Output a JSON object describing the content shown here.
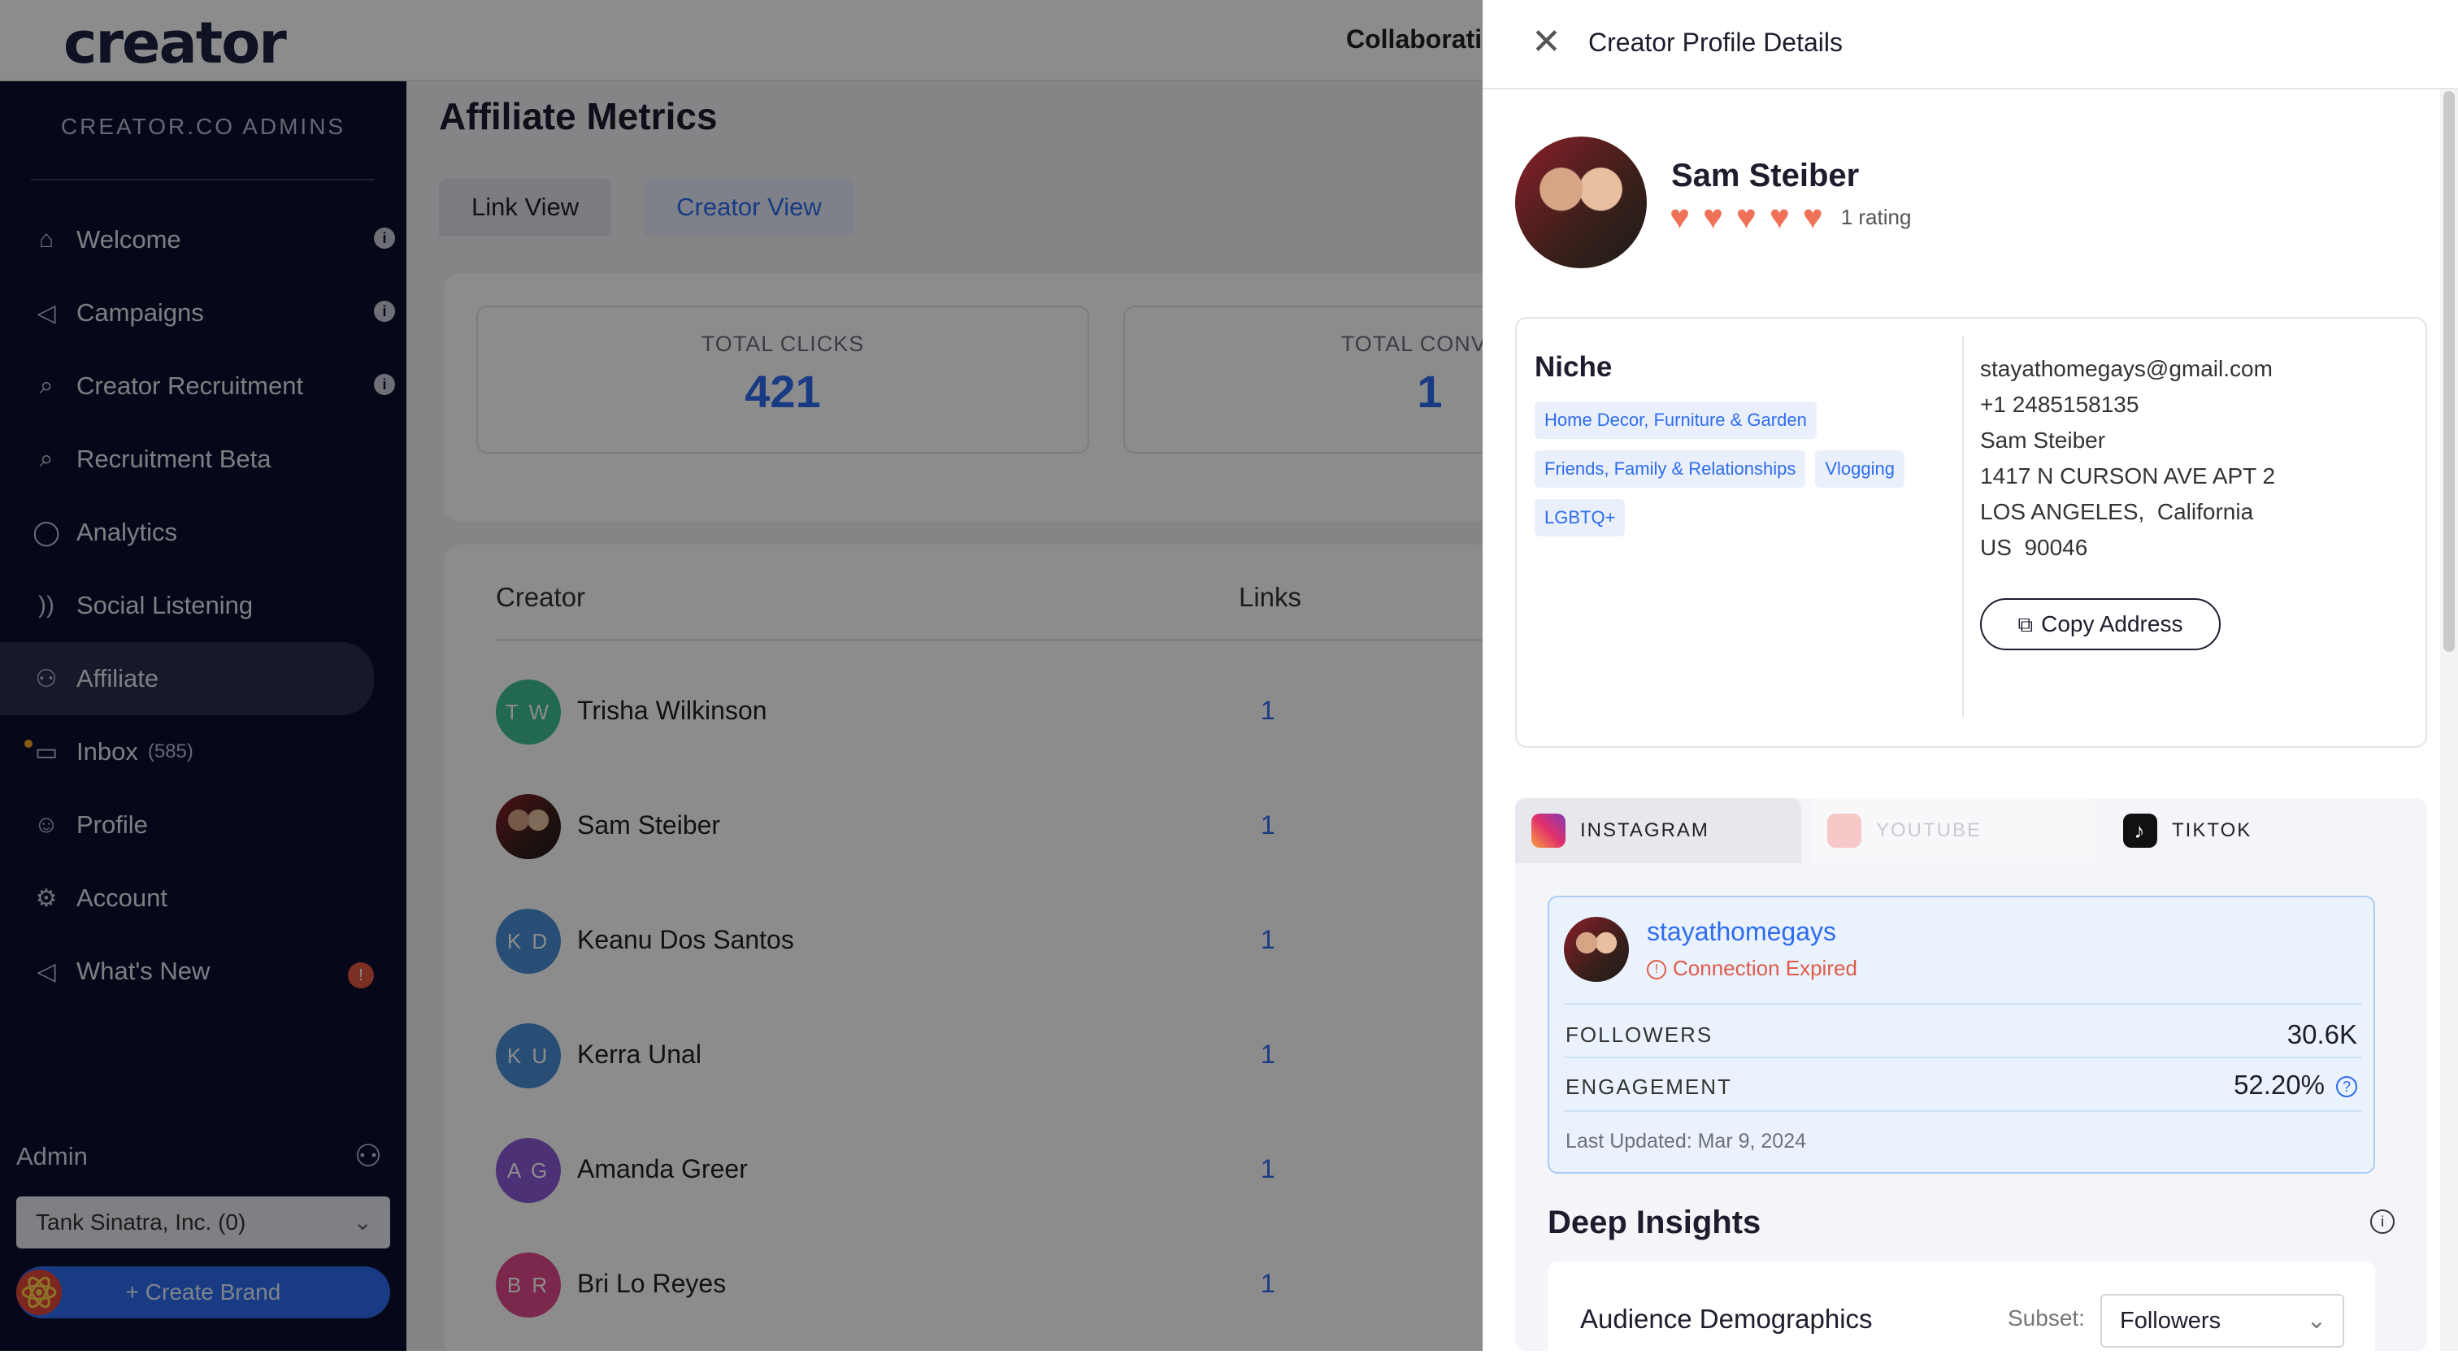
{
  "app": {
    "logo": "creator",
    "topnav_partial": "Collaborati"
  },
  "sidebar": {
    "title": "CREATOR.CO ADMINS",
    "items": [
      {
        "label": "Welcome",
        "icon": "home-icon",
        "glyph": "⌂",
        "info": true
      },
      {
        "label": "Campaigns",
        "icon": "megaphone-icon",
        "glyph": "◁",
        "info": true
      },
      {
        "label": "Creator Recruitment",
        "icon": "search-icon",
        "glyph": "⌕",
        "info": true
      },
      {
        "label": "Recruitment Beta",
        "icon": "search-icon",
        "glyph": "⌕"
      },
      {
        "label": "Analytics",
        "icon": "lightbulb-icon",
        "glyph": "◯"
      },
      {
        "label": "Social Listening",
        "icon": "soundwave-icon",
        "glyph": "))"
      },
      {
        "label": "Affiliate",
        "icon": "users-icon",
        "glyph": "⚇",
        "active": true
      },
      {
        "label": "Inbox",
        "count": "(585)",
        "icon": "inbox-icon",
        "glyph": "▭"
      },
      {
        "label": "Profile",
        "icon": "user-icon",
        "glyph": "☺"
      },
      {
        "label": "Account",
        "icon": "gear-icon",
        "glyph": "⚙"
      },
      {
        "label": "What's New",
        "icon": "announcement-icon",
        "glyph": "◁",
        "badge": "!"
      }
    ],
    "admin_label": "Admin",
    "brand_select": "Tank Sinatra, Inc. (0)",
    "create_brand": "+ Create Brand"
  },
  "main": {
    "title": "Affiliate Metrics",
    "tabs": [
      "Link View",
      "Creator View"
    ],
    "stats": [
      {
        "label": "TOTAL CLICKS",
        "value": "421"
      },
      {
        "label": "TOTAL CONVER",
        "value": "1"
      }
    ],
    "columns": [
      "Creator",
      "Links"
    ],
    "rows": [
      {
        "initials": "T W",
        "name": "Trisha Wilkinson",
        "links": "1",
        "color": "#3fbf93"
      },
      {
        "initials": "",
        "name": "Sam Steiber",
        "links": "1",
        "color": "#7a2a2a"
      },
      {
        "initials": "K D",
        "name": "Keanu Dos Santos",
        "links": "1",
        "color": "#4a8fd8"
      },
      {
        "initials": "K U",
        "name": "Kerra Unal",
        "links": "1",
        "color": "#4a8fd8"
      },
      {
        "initials": "A G",
        "name": "Amanda Greer",
        "links": "1",
        "color": "#8a5ad8"
      },
      {
        "initials": "B R",
        "name": "Bri Lo Reyes",
        "links": "1",
        "color": "#e04a8a"
      }
    ]
  },
  "panel": {
    "title": "Creator Profile Details",
    "name": "Sam Steiber",
    "rating_count": 5,
    "rating_text": "1 rating",
    "niche_title": "Niche",
    "niches": [
      "Home Decor, Furniture & Garden",
      "Friends, Family & Relationships",
      "Vlogging",
      "LGBTQ+"
    ],
    "contact": {
      "email": "stayathomegays@gmail.com",
      "phone": "+1 2485158135",
      "name": "Sam Steiber",
      "address1": "1417 N CURSON AVE APT 2",
      "city_state": "LOS ANGELES,  California",
      "country_zip": "US  90046"
    },
    "copy_address": "Copy Address",
    "social_tabs": [
      "INSTAGRAM",
      "YOUTUBE",
      "TIKTOK"
    ],
    "account": {
      "handle": "stayathomegays",
      "status": "Connection Expired",
      "followers_label": "FOLLOWERS",
      "followers": "30.6K",
      "engagement_label": "ENGAGEMENT",
      "engagement": "52.20%",
      "last_updated": "Last Updated: Mar 9, 2024"
    },
    "deep_insights": "Deep Insights",
    "demographics": {
      "title": "Audience Demographics",
      "subset_label": "Subset:",
      "subset_value": "Followers"
    }
  }
}
